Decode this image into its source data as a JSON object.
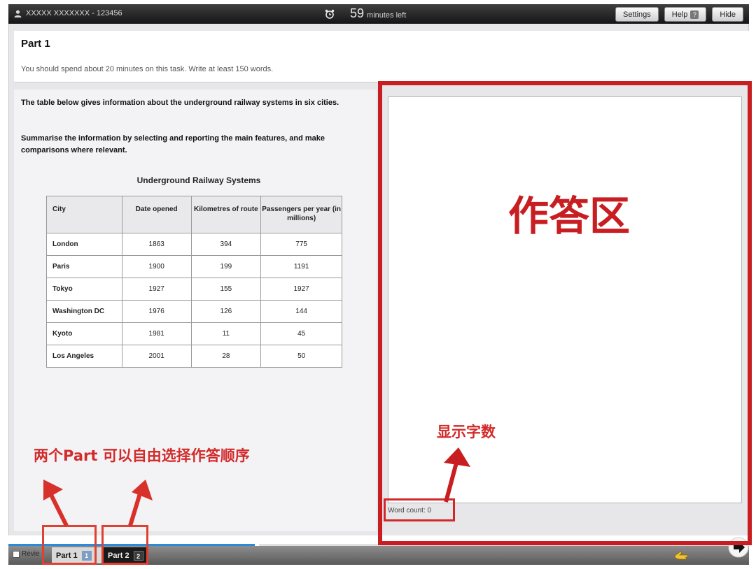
{
  "topbar": {
    "candidate": "XXXXX XXXXXXX - 123456",
    "time_value": "59",
    "time_label": "minutes left",
    "settings_label": "Settings",
    "help_label": "Help",
    "help_icon_text": "?",
    "hide_label": "Hide"
  },
  "part": {
    "title": "Part 1",
    "instruction": "You should spend about 20 minutes on this task. Write at least 150 words."
  },
  "question": {
    "prompt1": "The table below gives information about the underground railway systems in six cities.",
    "prompt2": "Summarise the information by selecting and reporting the main features, and make comparisons where relevant.",
    "table_title": "Underground Railway Systems",
    "headers": [
      "City",
      "Date opened",
      "Kilometres of route",
      "Passengers per year (in millions)"
    ],
    "rows": [
      [
        "London",
        "1863",
        "394",
        "775"
      ],
      [
        "Paris",
        "1900",
        "199",
        "1191"
      ],
      [
        "Tokyo",
        "1927",
        "155",
        "1927"
      ],
      [
        "Washington DC",
        "1976",
        "126",
        "144"
      ],
      [
        "Kyoto",
        "1981",
        "11",
        "45"
      ],
      [
        "Los Angeles",
        "2001",
        "28",
        "50"
      ]
    ]
  },
  "answer": {
    "value": "",
    "word_count_label": "Word count: 0"
  },
  "bottombar": {
    "review_label": "Revie",
    "part1_label": "Part 1",
    "part1_num": "1",
    "part2_label": "Part 2",
    "part2_num": "2"
  },
  "annotations": {
    "answer_area": "作答区",
    "word_count": "显示字数",
    "parts": "两个Part 可以自由选择作答顺序"
  },
  "colors": {
    "annotation_red": "#c81e22",
    "progress_blue": "#2c8ad8",
    "topbar_dark": "#151515"
  }
}
